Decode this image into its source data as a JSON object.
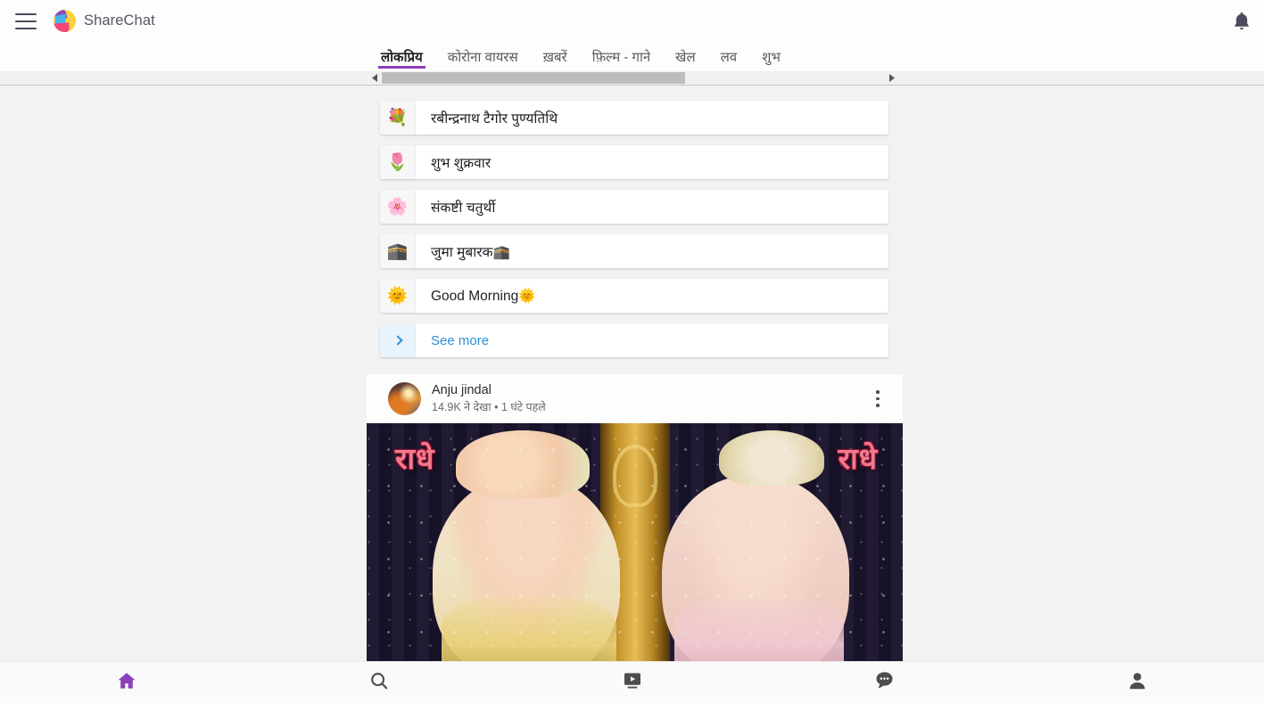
{
  "app": {
    "brand_name": "ShareChat",
    "accent_color": "#8b3fb8",
    "link_color": "#2e90d6"
  },
  "topbar": {
    "menu_icon": "hamburger-menu-icon",
    "logo_icon": "sharechat-logo-icon",
    "bell_icon": "notification-bell-icon"
  },
  "tabs": [
    {
      "label": "लोकप्रिय",
      "active": true
    },
    {
      "label": "कोरोना वायरस",
      "active": false
    },
    {
      "label": "ख़बरें",
      "active": false
    },
    {
      "label": "फ़िल्म - गाने",
      "active": false
    },
    {
      "label": "खेल",
      "active": false
    },
    {
      "label": "लव",
      "active": false
    },
    {
      "label": "शुभ",
      "active": false
    }
  ],
  "scrollbar": {
    "left_arrow": "◀",
    "right_arrow": "▶"
  },
  "topics": [
    {
      "icon": "💐",
      "icon_name": "bouquet-icon",
      "label": "रबीन्द्रनाथ टैगोर पुण्यतिथि"
    },
    {
      "icon": "🌷",
      "icon_name": "tulip-icon",
      "label": "शुभ शुक्रवार"
    },
    {
      "icon": "🌸",
      "icon_name": "cherry-blossom-icon",
      "label": "संकष्टी चतुर्थी"
    },
    {
      "icon": "🕋",
      "icon_name": "kaaba-icon",
      "label": "जुमा मुबारक🕋"
    },
    {
      "icon": "🌞",
      "icon_name": "sun-with-face-icon",
      "label": "Good Morning🌞"
    }
  ],
  "see_more": {
    "label": "See more",
    "icon_name": "chevron-right-icon"
  },
  "post": {
    "author": "Anju jindal",
    "meta": "14.9K ने देखा • 1 घंटे पहले",
    "menu_icon": "more-options-icon",
    "media_text_left": "राधे",
    "media_text_right": "राधे"
  },
  "bottom_nav": [
    {
      "name": "home",
      "icon": "home-icon",
      "active": true
    },
    {
      "name": "search",
      "icon": "search-icon",
      "active": false
    },
    {
      "name": "video",
      "icon": "video-icon",
      "active": false
    },
    {
      "name": "chat",
      "icon": "chat-bubble-icon",
      "active": false
    },
    {
      "name": "profile",
      "icon": "profile-icon",
      "active": false
    }
  ]
}
